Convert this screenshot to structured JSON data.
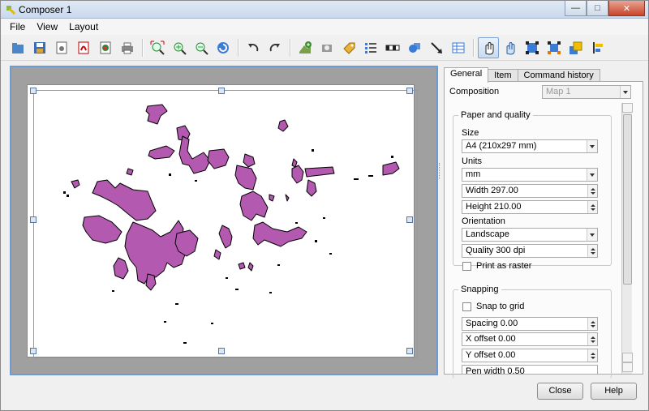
{
  "window": {
    "title": "Composer 1"
  },
  "menu": [
    "File",
    "View",
    "Layout"
  ],
  "toolbar": [
    {
      "name": "open-template-icon"
    },
    {
      "name": "save-template-icon"
    },
    {
      "name": "export-image-icon"
    },
    {
      "name": "export-pdf-icon"
    },
    {
      "name": "export-svg-icon"
    },
    {
      "name": "print-icon"
    },
    {
      "sep": true
    },
    {
      "name": "zoom-full-icon"
    },
    {
      "name": "zoom-in-icon"
    },
    {
      "name": "zoom-out-icon"
    },
    {
      "name": "refresh-icon"
    },
    {
      "sep": true
    },
    {
      "name": "undo-icon"
    },
    {
      "name": "redo-icon"
    },
    {
      "sep": true
    },
    {
      "name": "add-map-icon"
    },
    {
      "name": "add-image-icon"
    },
    {
      "name": "add-label-icon"
    },
    {
      "name": "add-legend-icon"
    },
    {
      "name": "add-scalebar-icon"
    },
    {
      "name": "add-shape-icon"
    },
    {
      "name": "add-arrow-icon"
    },
    {
      "name": "add-table-icon"
    },
    {
      "sep": true
    },
    {
      "name": "select-move-icon",
      "active": true
    },
    {
      "name": "move-content-icon"
    },
    {
      "name": "group-icon"
    },
    {
      "name": "ungroup-icon"
    },
    {
      "name": "raise-items-icon"
    },
    {
      "name": "align-items-icon"
    }
  ],
  "panel": {
    "tabs": [
      "General",
      "Item",
      "Command history"
    ],
    "composition_label": "Composition",
    "composition_value": "Map 1",
    "paper_group": "Paper and quality",
    "size_label": "Size",
    "size_value": "A4 (210x297 mm)",
    "units_label": "Units",
    "units_value": "mm",
    "width_value": "Width 297.00",
    "height_value": "Height 210.00",
    "orientation_label": "Orientation",
    "orientation_value": "Landscape",
    "quality_value": "Quality 300 dpi",
    "print_raster_label": "Print as raster",
    "snapping_group": "Snapping",
    "snap_grid_label": "Snap to grid",
    "spacing_value": "Spacing 0.00",
    "xoffset_value": "X offset 0.00",
    "yoffset_value": "Y offset 0.00",
    "penwidth_value": "Pen width 0.50"
  },
  "buttons": {
    "close": "Close",
    "help": "Help"
  },
  "colors": {
    "polygon_fill": "#b359b0",
    "polygon_stroke": "#000000",
    "selection_border": "#6d9ad4"
  }
}
